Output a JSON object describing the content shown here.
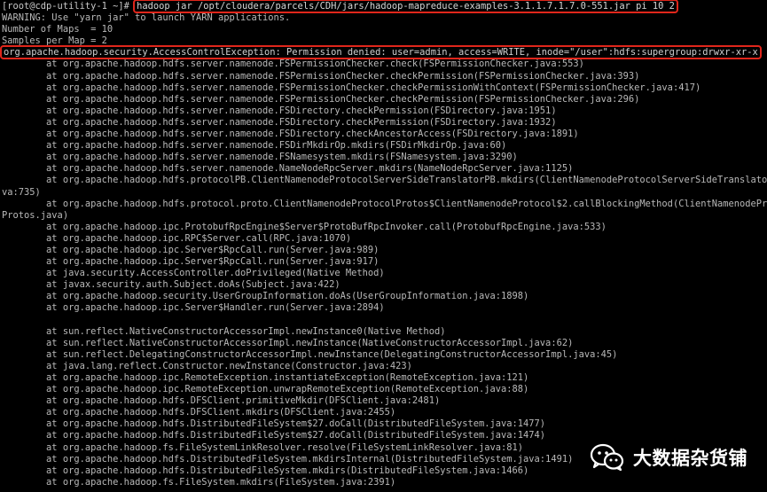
{
  "terminal": {
    "prompt": "[root@cdp-utility-1 ~]# ",
    "command": "hadoop jar /opt/cloudera/parcels/CDH/jars/hadoop-mapreduce-examples-3.1.1.7.1.7.0-551.jar pi 10 2",
    "lines": [
      "WARNING: Use \"yarn jar\" to launch YARN applications.",
      "Number of Maps  = 10",
      "Samples per Map = 2"
    ],
    "exception": "org.apache.hadoop.security.AccessControlException: Permission denied: user=admin, access=WRITE, inode=\"/user\":hdfs:supergroup:drwxr-xr-x",
    "stack": [
      "        at org.apache.hadoop.hdfs.server.namenode.FSPermissionChecker.check(FSPermissionChecker.java:553)",
      "        at org.apache.hadoop.hdfs.server.namenode.FSPermissionChecker.checkPermission(FSPermissionChecker.java:393)",
      "        at org.apache.hadoop.hdfs.server.namenode.FSPermissionChecker.checkPermissionWithContext(FSPermissionChecker.java:417)",
      "        at org.apache.hadoop.hdfs.server.namenode.FSPermissionChecker.checkPermission(FSPermissionChecker.java:296)",
      "        at org.apache.hadoop.hdfs.server.namenode.FSDirectory.checkPermission(FSDirectory.java:1951)",
      "        at org.apache.hadoop.hdfs.server.namenode.FSDirectory.checkPermission(FSDirectory.java:1932)",
      "        at org.apache.hadoop.hdfs.server.namenode.FSDirectory.checkAncestorAccess(FSDirectory.java:1891)",
      "        at org.apache.hadoop.hdfs.server.namenode.FSDirMkdirOp.mkdirs(FSDirMkdirOp.java:60)",
      "        at org.apache.hadoop.hdfs.server.namenode.FSNamesystem.mkdirs(FSNamesystem.java:3290)",
      "        at org.apache.hadoop.hdfs.server.namenode.NameNodeRpcServer.mkdirs(NameNodeRpcServer.java:1125)",
      "        at org.apache.hadoop.hdfs.protocolPB.ClientNamenodeProtocolServerSideTranslatorPB.mkdirs(ClientNamenodeProtocolServerSideTranslatorPB.ja",
      "va:735)",
      "        at org.apache.hadoop.hdfs.protocol.proto.ClientNamenodeProtocolProtos$ClientNamenodeProtocol$2.callBlockingMethod(ClientNamenodeProtocol",
      "Protos.java)",
      "        at org.apache.hadoop.ipc.ProtobufRpcEngine$Server$ProtoBufRpcInvoker.call(ProtobufRpcEngine.java:533)",
      "        at org.apache.hadoop.ipc.RPC$Server.call(RPC.java:1070)",
      "        at org.apache.hadoop.ipc.Server$RpcCall.run(Server.java:989)",
      "        at org.apache.hadoop.ipc.Server$RpcCall.run(Server.java:917)",
      "        at java.security.AccessController.doPrivileged(Native Method)",
      "        at javax.security.auth.Subject.doAs(Subject.java:422)",
      "        at org.apache.hadoop.security.UserGroupInformation.doAs(UserGroupInformation.java:1898)",
      "        at org.apache.hadoop.ipc.Server$Handler.run(Server.java:2894)",
      "",
      "        at sun.reflect.NativeConstructorAccessorImpl.newInstance0(Native Method)",
      "        at sun.reflect.NativeConstructorAccessorImpl.newInstance(NativeConstructorAccessorImpl.java:62)",
      "        at sun.reflect.DelegatingConstructorAccessorImpl.newInstance(DelegatingConstructorAccessorImpl.java:45)",
      "        at java.lang.reflect.Constructor.newInstance(Constructor.java:423)",
      "        at org.apache.hadoop.ipc.RemoteException.instantiateException(RemoteException.java:121)",
      "        at org.apache.hadoop.ipc.RemoteException.unwrapRemoteException(RemoteException.java:88)",
      "        at org.apache.hadoop.hdfs.DFSClient.primitiveMkdir(DFSClient.java:2481)",
      "        at org.apache.hadoop.hdfs.DFSClient.mkdirs(DFSClient.java:2455)",
      "        at org.apache.hadoop.hdfs.DistributedFileSystem$27.doCall(DistributedFileSystem.java:1477)",
      "        at org.apache.hadoop.hdfs.DistributedFileSystem$27.doCall(DistributedFileSystem.java:1474)",
      "        at org.apache.hadoop.fs.FileSystemLinkResolver.resolve(FileSystemLinkResolver.java:81)",
      "        at org.apache.hadoop.hdfs.DistributedFileSystem.mkdirsInternal(DistributedFileSystem.java:1491)",
      "        at org.apache.hadoop.hdfs.DistributedFileSystem.mkdirs(DistributedFileSystem.java:1466)",
      "        at org.apache.hadoop.fs.FileSystem.mkdirs(FileSystem.java:2391)"
    ]
  },
  "watermark": {
    "icon": "wechat-icon",
    "text": "大数据杂货铺"
  },
  "colors": {
    "background": "#000000",
    "text": "#b9b9b9",
    "highlight_border": "#e0261b"
  }
}
